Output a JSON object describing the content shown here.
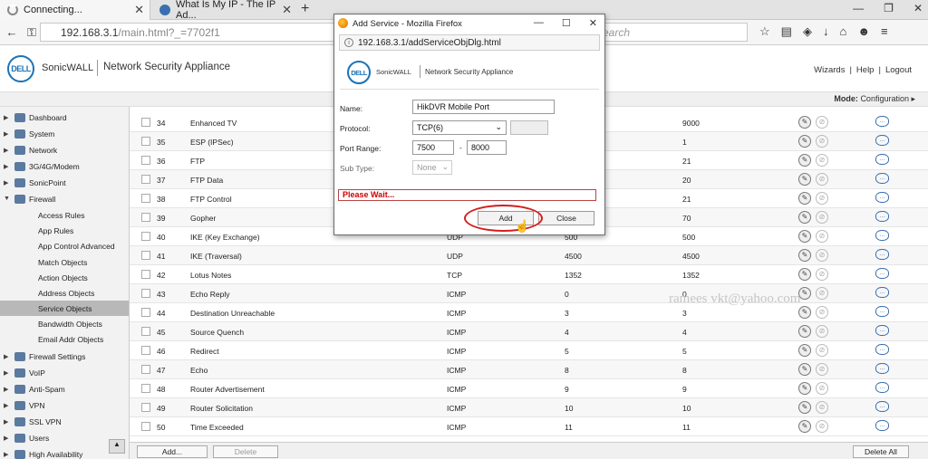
{
  "browser": {
    "tabs": [
      {
        "label": "Connecting..."
      },
      {
        "label": "What Is My IP - The IP Ad..."
      }
    ],
    "url_host": "192.168.3.1",
    "url_path": "/main.html?_=7702f1",
    "search_placeholder": "earch"
  },
  "header": {
    "logo": "DELL",
    "brand": "SonicWALL",
    "product": "Network Security Appliance",
    "links": [
      "Wizards",
      "|",
      "Help",
      "|",
      "Logout"
    ],
    "mode_label": "Mode:",
    "mode_value": "Configuration ▸"
  },
  "sidebar": {
    "items": [
      {
        "label": "Dashboard"
      },
      {
        "label": "System"
      },
      {
        "label": "Network"
      },
      {
        "label": "3G/4G/Modem"
      },
      {
        "label": "SonicPoint"
      },
      {
        "label": "Firewall"
      }
    ],
    "firewall_sub": [
      {
        "label": "Access Rules"
      },
      {
        "label": "App Rules"
      },
      {
        "label": "App Control Advanced"
      },
      {
        "label": "Match Objects"
      },
      {
        "label": "Action Objects"
      },
      {
        "label": "Address Objects"
      },
      {
        "label": "Service Objects"
      },
      {
        "label": "Bandwidth Objects"
      },
      {
        "label": "Email Addr Objects"
      }
    ],
    "items_after": [
      {
        "label": "Firewall Settings"
      },
      {
        "label": "VoIP"
      },
      {
        "label": "Anti-Spam"
      },
      {
        "label": "VPN"
      },
      {
        "label": "SSL VPN"
      },
      {
        "label": "Users"
      },
      {
        "label": "High Availability"
      }
    ]
  },
  "table": {
    "rows": [
      {
        "num": "34",
        "name": "Enhanced TV",
        "proto": "",
        "start": "",
        "end": "9000"
      },
      {
        "num": "35",
        "name": "ESP (IPSec)",
        "proto": "",
        "start": "",
        "end": "1"
      },
      {
        "num": "36",
        "name": "FTP",
        "proto": "",
        "start": "",
        "end": "21"
      },
      {
        "num": "37",
        "name": "FTP Data",
        "proto": "",
        "start": "",
        "end": "20"
      },
      {
        "num": "38",
        "name": "FTP Control",
        "proto": "",
        "start": "",
        "end": "21"
      },
      {
        "num": "39",
        "name": "Gopher",
        "proto": "",
        "start": "",
        "end": "70"
      },
      {
        "num": "40",
        "name": "IKE (Key Exchange)",
        "proto": "UDP",
        "start": "500",
        "end": "500"
      },
      {
        "num": "41",
        "name": "IKE (Traversal)",
        "proto": "UDP",
        "start": "4500",
        "end": "4500"
      },
      {
        "num": "42",
        "name": "Lotus Notes",
        "proto": "TCP",
        "start": "1352",
        "end": "1352"
      },
      {
        "num": "43",
        "name": "Echo Reply",
        "proto": "ICMP",
        "start": "0",
        "end": "0"
      },
      {
        "num": "44",
        "name": "Destination Unreachable",
        "proto": "ICMP",
        "start": "3",
        "end": "3"
      },
      {
        "num": "45",
        "name": "Source Quench",
        "proto": "ICMP",
        "start": "4",
        "end": "4"
      },
      {
        "num": "46",
        "name": "Redirect",
        "proto": "ICMP",
        "start": "5",
        "end": "5"
      },
      {
        "num": "47",
        "name": "Echo",
        "proto": "ICMP",
        "start": "8",
        "end": "8"
      },
      {
        "num": "48",
        "name": "Router Advertisement",
        "proto": "ICMP",
        "start": "9",
        "end": "9"
      },
      {
        "num": "49",
        "name": "Router Solicitation",
        "proto": "ICMP",
        "start": "10",
        "end": "10"
      },
      {
        "num": "50",
        "name": "Time Exceeded",
        "proto": "ICMP",
        "start": "11",
        "end": "11"
      }
    ],
    "add_label": "Add...",
    "delete_label": "Delete",
    "delete_all_label": "Delete All"
  },
  "watermark": "ramees vkt@yahoo.com",
  "dialog": {
    "title": "Add Service - Mozilla Firefox",
    "url": "192.168.3.1/addServiceObjDlg.html",
    "brand": "SonicWALL",
    "product": "Network Security Appliance",
    "name_label": "Name:",
    "name_value": "HikDVR Mobile Port",
    "protocol_label": "Protocol:",
    "protocol_value": "TCP(6)",
    "port_range_label": "Port Range:",
    "port_start": "7500",
    "port_dash": "-",
    "port_end": "8000",
    "subtype_label": "Sub Type:",
    "subtype_value": "None",
    "status": "Please Wait...",
    "add_label": "Add",
    "close_label": "Close"
  }
}
